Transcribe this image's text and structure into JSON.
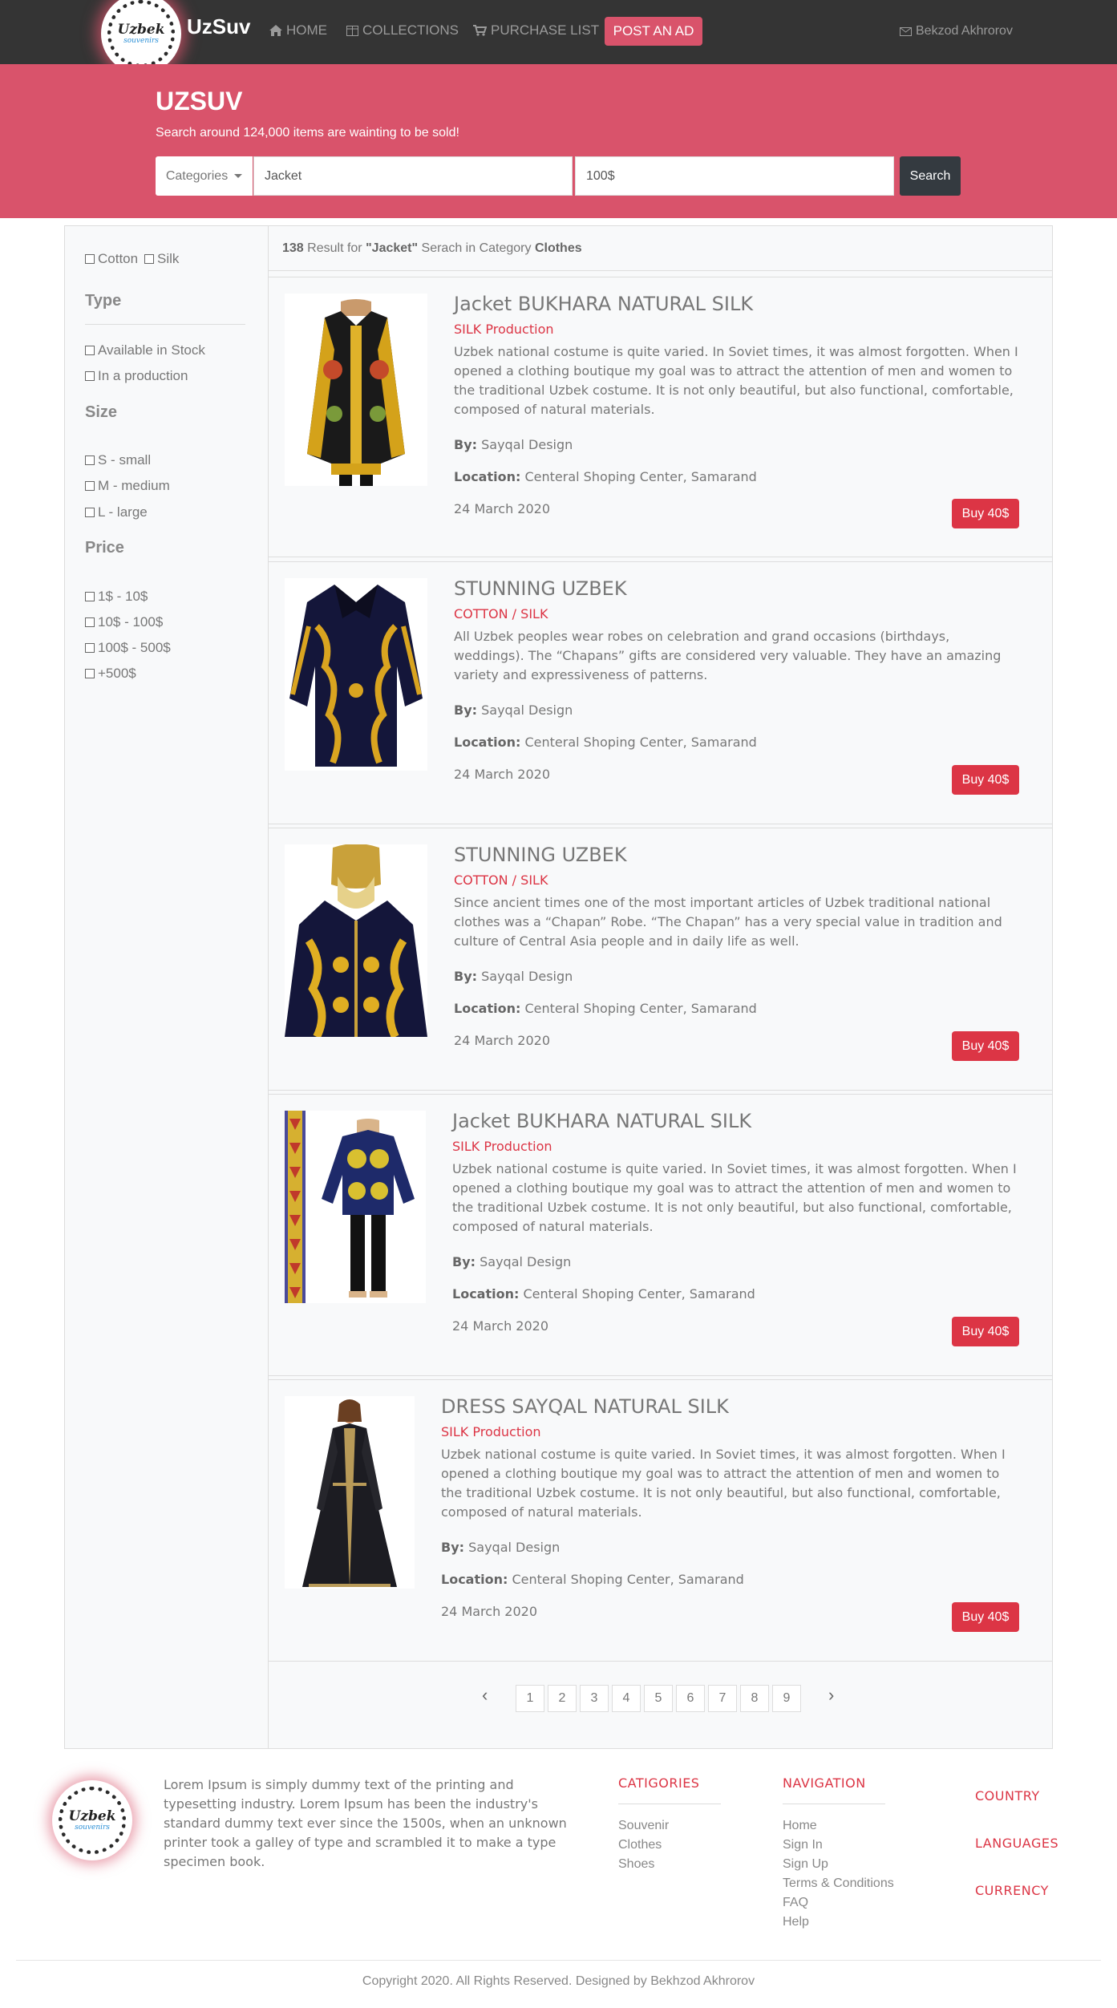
{
  "navbar": {
    "logo_text": "Uzbek",
    "logo_subtext": "souvenirs",
    "brand": "UzSuv",
    "links": [
      {
        "label": "HOME",
        "icon": "home-icon"
      },
      {
        "label": "COLLECTIONS",
        "icon": "collections-icon"
      },
      {
        "label": "PURCHASE LIST",
        "icon": "cart-icon"
      }
    ],
    "post_ad": "POST AN AD",
    "user": "Bekzod Akhrorov",
    "accent": "#d9536b"
  },
  "hero": {
    "title": "UZSUV",
    "subtitle": "Search around 124,000 items are wainting to be sold!",
    "categories_label": "Categories",
    "query": "Jacket",
    "price": "100$",
    "search_label": "Search"
  },
  "sidebar": {
    "materials": [
      "Cotton",
      "Silk"
    ],
    "type_heading": "Type",
    "types": [
      "Available in Stock",
      "In a production"
    ],
    "size_heading": "Size",
    "sizes": [
      "S - small",
      "M - medium",
      "L - large"
    ],
    "price_heading": "Price",
    "prices": [
      "1$ - 10$",
      "10$ - 100$",
      "100$ - 500$",
      "+500$"
    ]
  },
  "results": {
    "count": "138",
    "result_for": "Result for",
    "query": "\"Jacket\"",
    "in_category": "Serach in Category",
    "category": "Clothes"
  },
  "products": [
    {
      "title": "Jacket BUKHARA NATURAL SILK",
      "subtitle": "SILK Production",
      "description": "Uzbek national costume is quite varied. In Soviet times, it was almost forgotten. When I opened a clothing boutique my goal was to attract the attention of men and women to the traditional Uzbek costume. It is not only beautiful, but also functional, comfortable, composed of natural materials.",
      "by_label": "By:",
      "by": "Sayqal Design",
      "location_label": "Location:",
      "location": "Centeral Shoping Center, Samarand",
      "date": "24 March 2020",
      "buy": "Buy 40$"
    },
    {
      "title": "STUNNING UZBEK",
      "subtitle": "COTTON / SILK",
      "description": "All Uzbek peoples wear robes on celebration and grand occasions (birthdays, weddings). The “Chapans” gifts are considered very valuable. They have an amazing variety and expressiveness of patterns.",
      "by_label": "By:",
      "by": "Sayqal Design",
      "location_label": "Location:",
      "location": "Centeral Shoping Center, Samarand",
      "date": "24 March 2020",
      "buy": "Buy 40$"
    },
    {
      "title": "STUNNING UZBEK",
      "subtitle": "COTTON / SILK",
      "description": "Since ancient times one of the most important articles of Uzbek traditional national clothes was a “Chapan” Robe. “The Chapan” has a very special value in tradition and culture of Central Asia people and in daily life as well.",
      "by_label": "By:",
      "by": "Sayqal Design",
      "location_label": "Location:",
      "location": "Centeral Shoping Center, Samarand",
      "date": "24 March 2020",
      "buy": "Buy 40$"
    },
    {
      "title": "Jacket BUKHARA NATURAL SILK",
      "subtitle": "SILK Production",
      "description": "Uzbek national costume is quite varied. In Soviet times, it was almost forgotten. When I opened a clothing boutique my goal was to attract the attention of men and women to the traditional Uzbek costume. It is not only beautiful, but also functional, comfortable, composed of natural materials.",
      "by_label": "By:",
      "by": "Sayqal Design",
      "location_label": "Location:",
      "location": "Centeral Shoping Center, Samarand",
      "date": "24 March 2020",
      "buy": "Buy 40$"
    },
    {
      "title": "DRESS SAYQAL NATURAL SILK",
      "subtitle": "SILK Production",
      "description": "Uzbek national costume is quite varied. In Soviet times, it was almost forgotten. When I opened a clothing boutique my goal was to attract the attention of men and women to the traditional Uzbek costume. It is not only beautiful, but also functional, comfortable, composed of natural materials.",
      "by_label": "By:",
      "by": "Sayqal Design",
      "location_label": "Location:",
      "location": "Centeral Shoping Center, Samarand",
      "date": "24 March 2020",
      "buy": "Buy 40$"
    }
  ],
  "pagination": {
    "prev": "‹",
    "pages": [
      "1",
      "2",
      "3",
      "4",
      "5",
      "6",
      "7",
      "8",
      "9"
    ],
    "next": "›"
  },
  "footer": {
    "logo_text": "Uzbek",
    "logo_subtext": "souvenirs",
    "about": "Lorem Ipsum is simply dummy text of the printing and typesetting industry. Lorem Ipsum has been the industry's standard dummy text ever since the 1500s, when an unknown printer took a galley of type and scrambled it to make a type specimen book.",
    "categories_heading": "CATIGORIES",
    "categories": [
      "Souvenir",
      "Clothes",
      "Shoes"
    ],
    "navigation_heading": "NAVIGATION",
    "navigation": [
      "Home",
      "Sign In",
      "Sign Up",
      "Terms & Conditions",
      "FAQ",
      "Help"
    ],
    "country": "COUNTRY",
    "languages": "LANGUAGES",
    "currency": "CURRENCY",
    "copyright": "Copyright 2020. All Rights Reserved. Designed by Bekhzod Akhrorov"
  }
}
